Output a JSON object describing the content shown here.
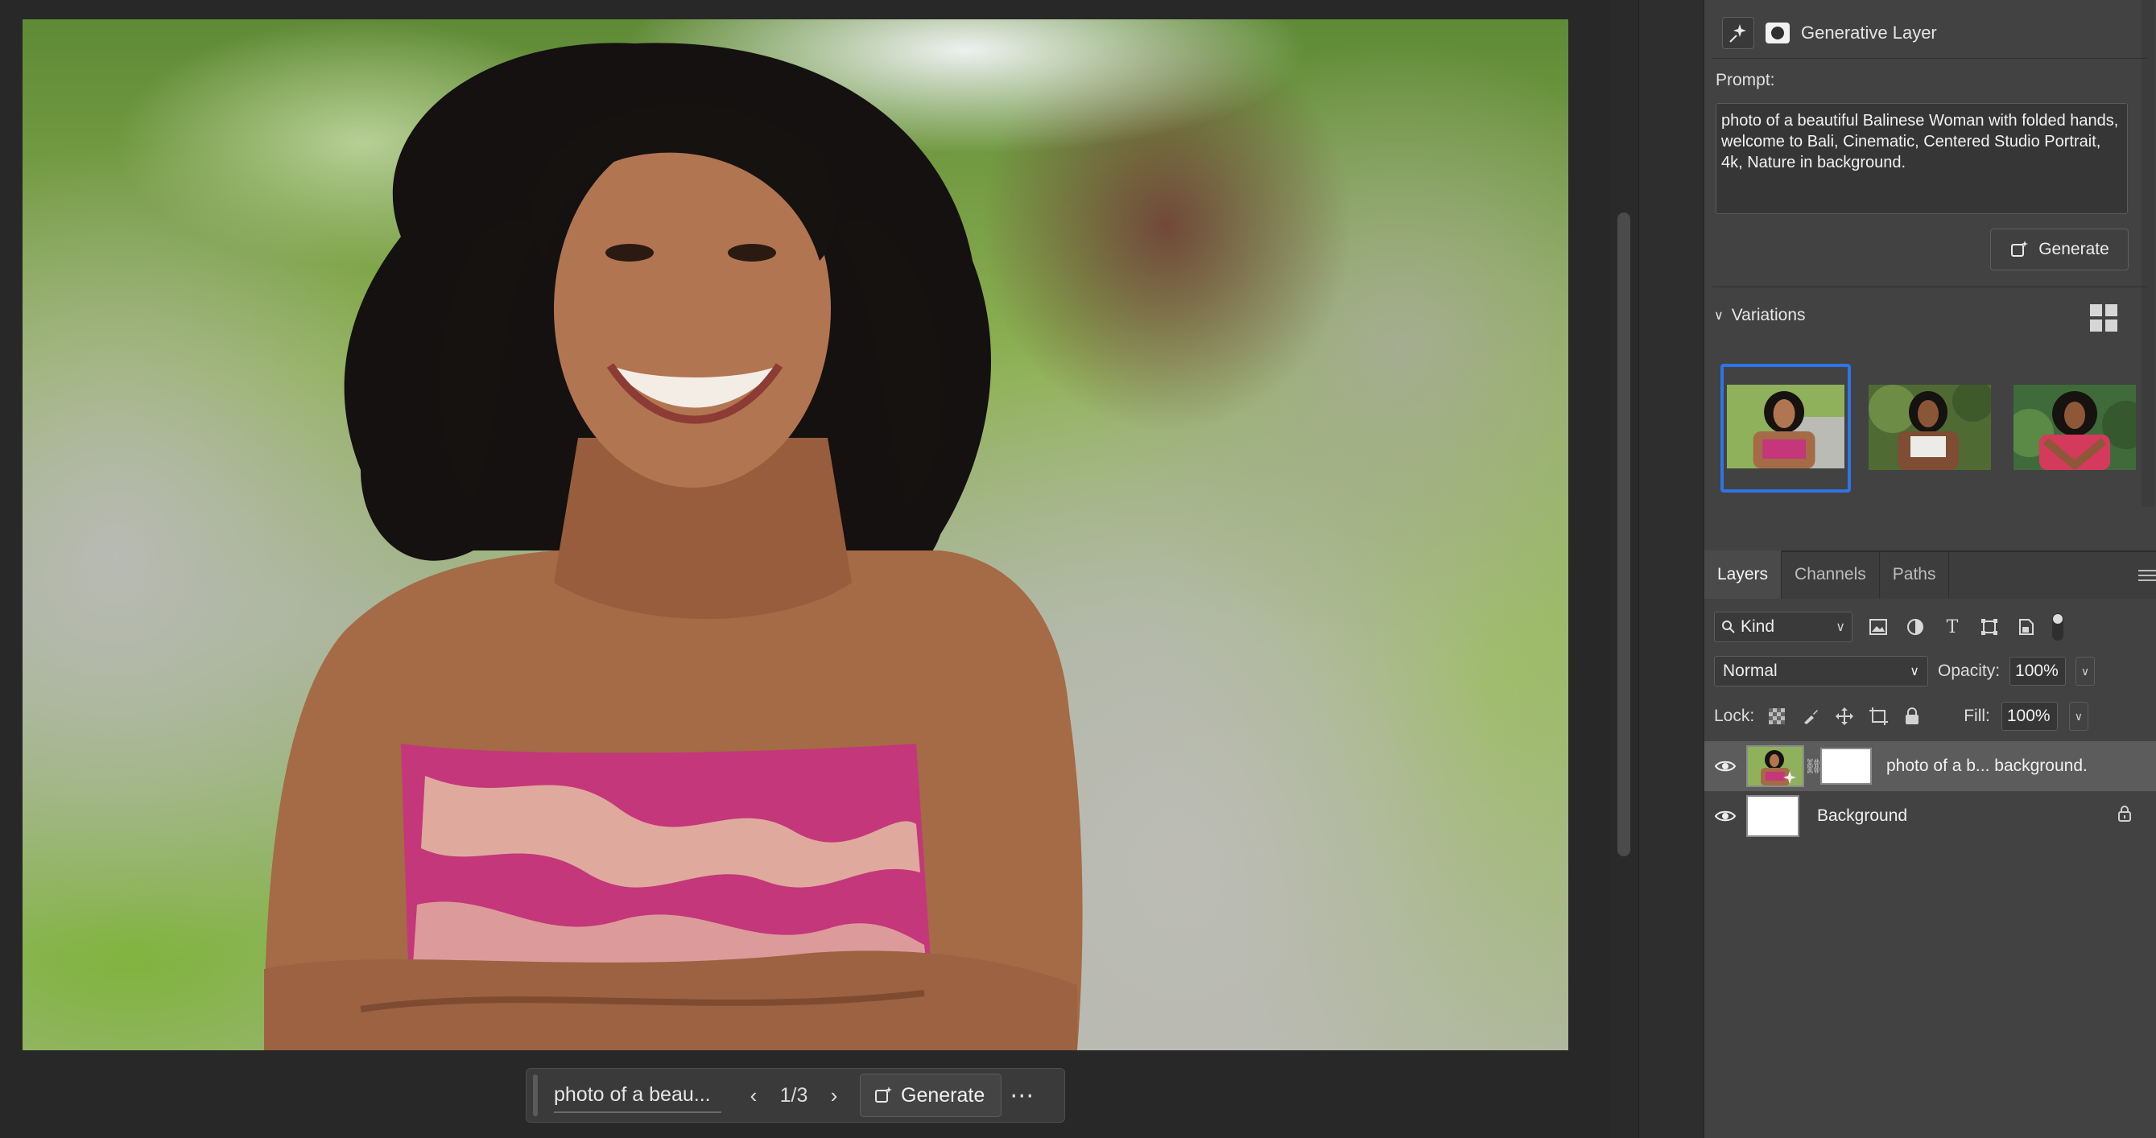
{
  "canvas": {
    "image_alt": "Smiling woman with curly hair in a pink patterned top, arms crossed, garden path background"
  },
  "taskbar": {
    "prompt_preview": "photo of a beau...",
    "prev_icon": "chevron-left-icon",
    "counter": "1/3",
    "next_icon": "chevron-right-icon",
    "generate_label": "Generate",
    "more_icon": "more-horizontal-icon"
  },
  "properties": {
    "layer_type": "Generative Layer",
    "prompt_label": "Prompt:",
    "prompt_text": "photo of a beautiful Balinese Woman with folded hands, welcome to Bali, Cinematic, Centered Studio Portrait, 4k, Nature in background.",
    "generate_label": "Generate",
    "variations_label": "Variations",
    "variations_count": 3,
    "selected_variation": 1
  },
  "layers_panel": {
    "tabs": [
      {
        "label": "Layers",
        "active": true
      },
      {
        "label": "Channels",
        "active": false
      },
      {
        "label": "Paths",
        "active": false
      }
    ],
    "filter_kind": "Kind",
    "blend_mode": "Normal",
    "opacity_label": "Opacity:",
    "opacity_value": "100%",
    "lock_label": "Lock:",
    "fill_label": "Fill:",
    "fill_value": "100%",
    "layers": [
      {
        "name": "photo of a b... background.",
        "visible": true,
        "selected": true
      },
      {
        "name": "Background",
        "visible": true,
        "locked": true
      }
    ]
  },
  "colors": {
    "accent": "#2f74e6",
    "panel_bg": "#424242",
    "canvas_bg": "#282828"
  }
}
